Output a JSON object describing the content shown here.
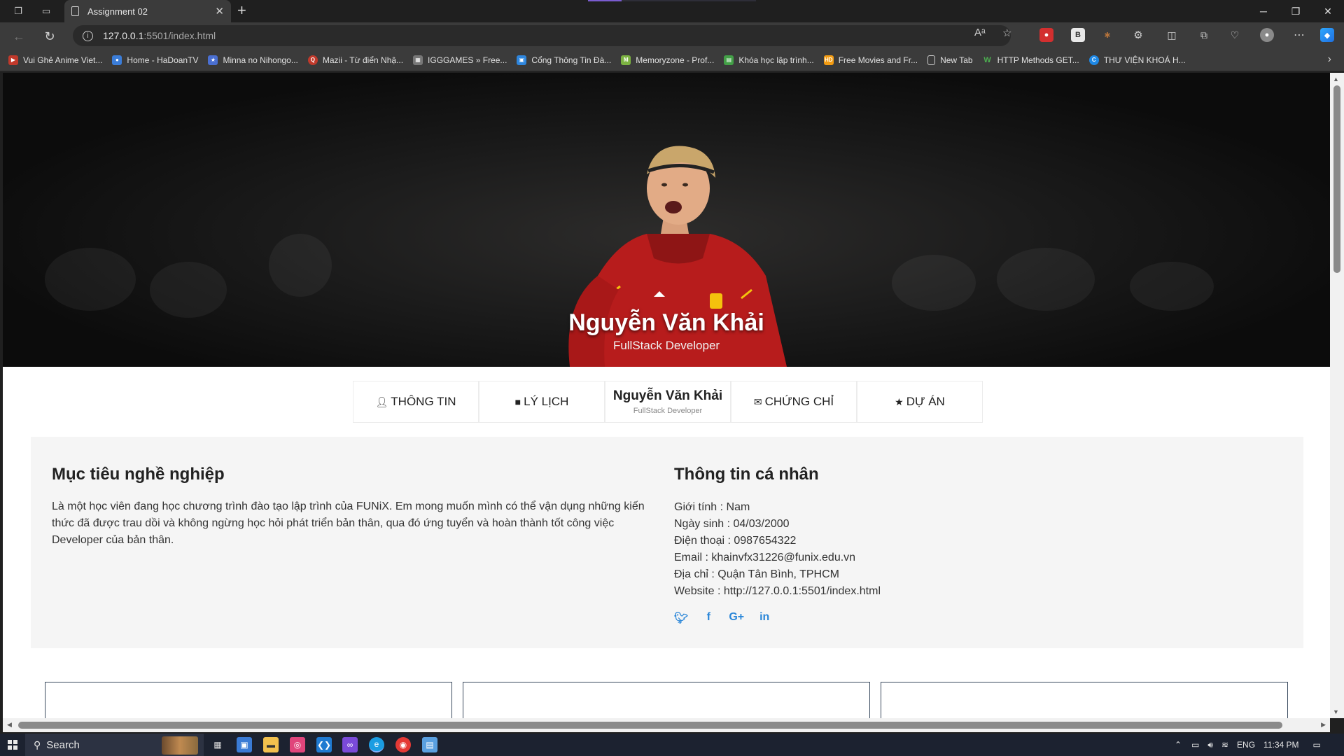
{
  "browser": {
    "tab_title": "Assignment 02",
    "url_host": "127.0.0.1",
    "url_path": ":5501/index.html",
    "bookmarks": [
      {
        "label": "Vui Ghẻ Anime Viet...",
        "color": "#c0392b",
        "icon": "play-icon"
      },
      {
        "label": "Home - HaDoanTV",
        "color": "#3b7dd8",
        "icon": "tv-icon"
      },
      {
        "label": "Minna no Nihongo...",
        "color": "#4a6fd1",
        "icon": "book-icon"
      },
      {
        "label": "Mazii - Từ điển Nhậ...",
        "color": "#c0392b",
        "icon": "dictionary-icon"
      },
      {
        "label": "IGGGAMES » Free...",
        "color": "#777777",
        "icon": "game-icon"
      },
      {
        "label": "Cổng Thông Tin Đà...",
        "color": "#2e86de",
        "icon": "portal-icon"
      },
      {
        "label": "Memoryzone - Prof...",
        "color": "#7cb342",
        "icon": "memory-icon"
      },
      {
        "label": "Khóa học lập trình...",
        "color": "#43a047",
        "icon": "course-icon"
      },
      {
        "label": "Free Movies and Fr...",
        "color": "#f39c12",
        "icon": "movie-icon"
      },
      {
        "label": "New Tab",
        "color": "#555555",
        "icon": "page-icon"
      },
      {
        "label": "HTTP Methods GET...",
        "color": "#2e7d32",
        "icon": "http-icon"
      },
      {
        "label": "THƯ VIỆN KHOÁ H...",
        "color": "#1e88e5",
        "icon": "library-icon"
      }
    ]
  },
  "hero": {
    "name": "Nguyễn Văn Khải",
    "title": "FullStack Developer"
  },
  "menu": {
    "info": "THÔNG TIN",
    "resume": "LÝ LỊCH",
    "center_name": "Nguyễn Văn Khải",
    "center_title": "FullStack Developer",
    "certs": "CHỨNG CHỈ",
    "projects": "DỰ ÁN"
  },
  "about": {
    "objective_heading": "Mục tiêu nghề nghiệp",
    "objective_text": "Là một học viên đang học chương trình đào tạo lập trình của FUNiX. Em mong muốn mình có thể vận dụng những kiến thức đã được trau dồi và không ngừng học hỏi phát triển bản thân, qua đó ứng tuyển và hoàn thành tốt công việc Developer của bản thân.",
    "personal_heading": "Thông tin cá nhân",
    "gender": "Giới tính : Nam",
    "dob": "Ngày sinh : 04/03/2000",
    "phone": "Điện thoại : 0987654322",
    "email": "Email : khainvfx31226@funix.edu.vn",
    "address": "Địa chỉ : Quận Tân Bình, TPHCM",
    "website": "Website : http://127.0.0.1:5501/index.html",
    "social": {
      "twitter": "twitter-icon",
      "facebook": "facebook-icon",
      "gplus": "google-plus-icon",
      "linkedin": "linkedin-icon"
    }
  },
  "taskbar": {
    "search_label": "Search",
    "lang": "ENG",
    "time": "11:34 PM"
  }
}
